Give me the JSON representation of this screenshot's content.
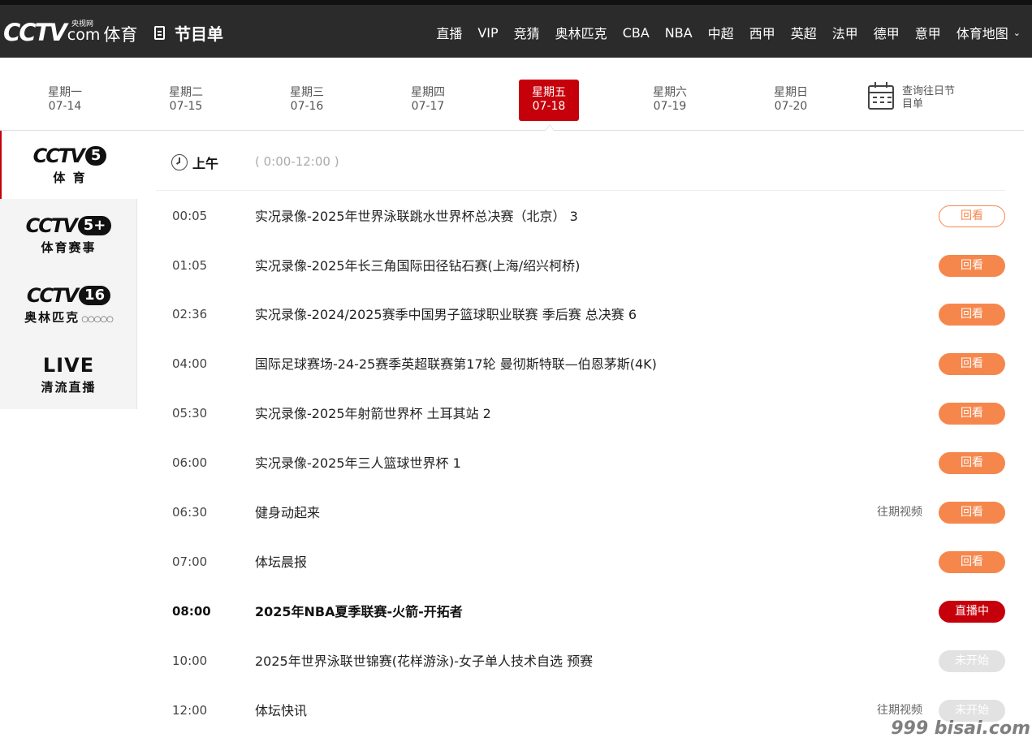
{
  "header": {
    "logo_cctv": "CCTV",
    "logo_small": "央视网",
    "logo_com": "com",
    "logo_sport": "体育",
    "page_title": "节目单",
    "nav": [
      "直播",
      "VIP",
      "竞猜",
      "奥林匹克",
      "CBA",
      "NBA",
      "中超",
      "西甲",
      "英超",
      "法甲",
      "德甲",
      "意甲",
      "体育地图"
    ]
  },
  "days": [
    {
      "weekday": "星期一",
      "date": "07-14"
    },
    {
      "weekday": "星期二",
      "date": "07-15"
    },
    {
      "weekday": "星期三",
      "date": "07-16"
    },
    {
      "weekday": "星期四",
      "date": "07-17"
    },
    {
      "weekday": "星期五",
      "date": "07-18"
    },
    {
      "weekday": "星期六",
      "date": "07-19"
    },
    {
      "weekday": "星期日",
      "date": "07-20"
    }
  ],
  "history": {
    "line1": "查询往日节",
    "line2": "目单"
  },
  "channels": [
    {
      "mark": "CCTV",
      "num": "5",
      "sub": "体 育"
    },
    {
      "mark": "CCTV",
      "num": "5+",
      "sub": "体育赛事"
    },
    {
      "mark": "CCTV",
      "num": "16",
      "sub": "奥林匹克"
    },
    {
      "mark": "LIVE",
      "sub": "清流直播"
    }
  ],
  "period": {
    "label": "上午",
    "range": "( 0:00-12:00 )"
  },
  "programs": [
    {
      "time": "00:05",
      "title": "实况录像-2025年世界泳联跳水世界杯总决赛（北京） 3",
      "past": "",
      "status": "回看"
    },
    {
      "time": "01:05",
      "title": "实况录像-2025年长三角国际田径钻石赛(上海/绍兴柯桥)",
      "past": "",
      "status": "回看"
    },
    {
      "time": "02:36",
      "title": "实况录像-2024/2025赛季中国男子篮球职业联赛 季后赛 总决赛 6",
      "past": "",
      "status": "回看"
    },
    {
      "time": "04:00",
      "title": "国际足球赛场-24-25赛季英超联赛第17轮 曼彻斯特联—伯恩茅斯(4K)",
      "past": "",
      "status": "回看"
    },
    {
      "time": "05:30",
      "title": "实况录像-2025年射箭世界杯 土耳其站 2",
      "past": "",
      "status": "回看"
    },
    {
      "time": "06:00",
      "title": "实况录像-2025年三人篮球世界杯 1",
      "past": "",
      "status": "回看"
    },
    {
      "time": "06:30",
      "title": "健身动起来",
      "past": "往期视频",
      "status": "回看"
    },
    {
      "time": "07:00",
      "title": "体坛晨报",
      "past": "",
      "status": "回看"
    },
    {
      "time": "08:00",
      "title": "2025年NBA夏季联赛-火箭-开拓者",
      "past": "",
      "status": "直播中"
    },
    {
      "time": "10:00",
      "title": "2025年世界泳联世锦赛(花样游泳)-女子单人技术自选 预赛",
      "past": "",
      "status": "未开始"
    },
    {
      "time": "12:00",
      "title": "体坛快讯",
      "past": "往期视频",
      "status": "未开始"
    }
  ],
  "watermark": "999 bisai.com",
  "colors": {
    "brand_red": "#c6000b",
    "replay_orange": "#f6874c",
    "header_bg": "#2b2b2b"
  }
}
